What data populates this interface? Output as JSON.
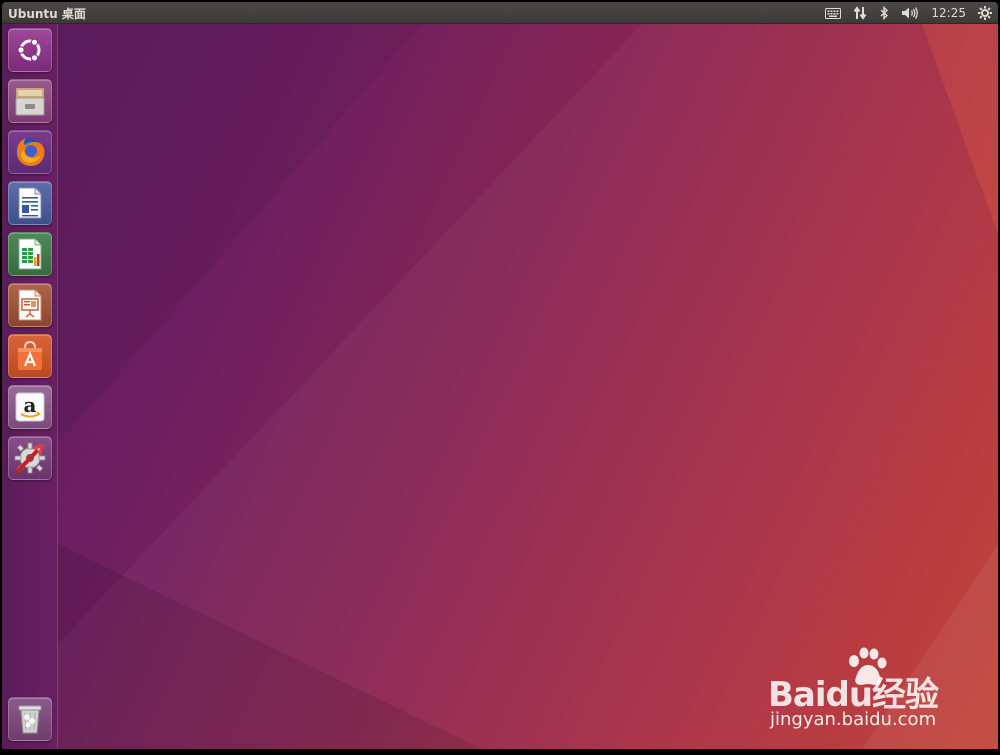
{
  "panel": {
    "title": "Ubuntu 桌面",
    "clock": "12:25",
    "indicators": [
      "keyboard-icon",
      "network-icon",
      "bluetooth-icon",
      "volume-icon",
      "gear-icon"
    ]
  },
  "launcher": {
    "items": [
      {
        "id": "dash",
        "icon": "ubuntu-logo-icon"
      },
      {
        "id": "files",
        "icon": "file-cabinet-icon"
      },
      {
        "id": "firefox",
        "icon": "firefox-icon"
      },
      {
        "id": "writer",
        "icon": "libreoffice-writer-icon"
      },
      {
        "id": "calc",
        "icon": "libreoffice-calc-icon"
      },
      {
        "id": "impress",
        "icon": "libreoffice-impress-icon"
      },
      {
        "id": "software",
        "icon": "software-center-icon"
      },
      {
        "id": "amazon",
        "icon": "amazon-icon"
      },
      {
        "id": "settings",
        "icon": "system-settings-icon"
      },
      {
        "id": "trash",
        "icon": "trash-icon"
      }
    ]
  },
  "watermark": {
    "logo_text": "Baidu经验",
    "url": "jingyan.baidu.com"
  },
  "colors": {
    "panel": "#3c3b37",
    "launcher": "#5e1d5c",
    "desktop_start": "#5e1c63",
    "desktop_end": "#c23d31"
  }
}
